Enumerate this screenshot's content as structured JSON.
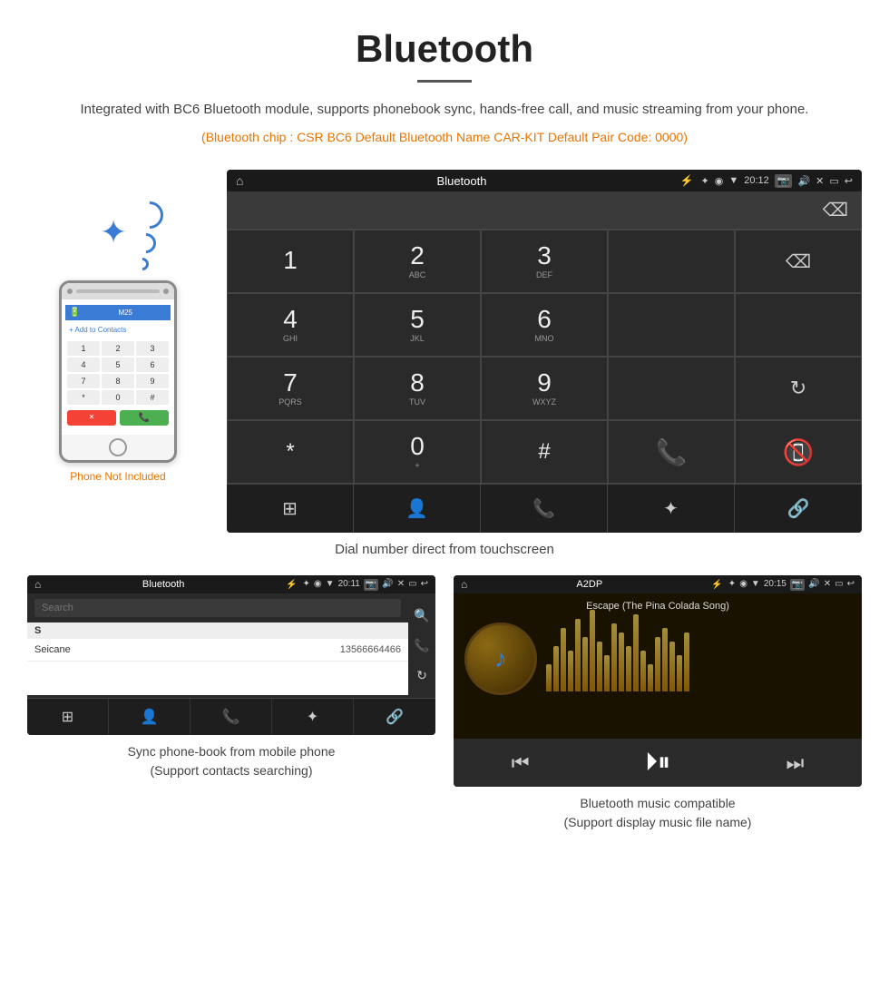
{
  "header": {
    "title": "Bluetooth",
    "underline": true,
    "description": "Integrated with BC6 Bluetooth module, supports phonebook sync, hands-free call, and music streaming from your phone.",
    "chip_info": "(Bluetooth chip : CSR BC6    Default Bluetooth Name CAR-KIT    Default Pair Code: 0000)"
  },
  "phone_illustration": {
    "not_included_label": "Phone Not Included"
  },
  "car_dial_screen": {
    "status_bar": {
      "title": "Bluetooth",
      "time": "20:12"
    },
    "dialpad": {
      "keys": [
        {
          "main": "1",
          "sub": ""
        },
        {
          "main": "2",
          "sub": "ABC"
        },
        {
          "main": "3",
          "sub": "DEF"
        },
        {
          "main": "4",
          "sub": "GHI"
        },
        {
          "main": "5",
          "sub": "JKL"
        },
        {
          "main": "6",
          "sub": "MNO"
        },
        {
          "main": "7",
          "sub": "PQRS"
        },
        {
          "main": "8",
          "sub": "TUV"
        },
        {
          "main": "9",
          "sub": "WXYZ"
        },
        {
          "main": "*",
          "sub": ""
        },
        {
          "main": "0",
          "sub": "+"
        },
        {
          "main": "#",
          "sub": ""
        }
      ]
    },
    "caption": "Dial number direct from touchscreen"
  },
  "phonebook_screen": {
    "status_bar": {
      "title": "Bluetooth",
      "time": "20:11"
    },
    "search_placeholder": "Search",
    "contacts": [
      {
        "letter": "S",
        "name": "Seicane",
        "number": "13566664466"
      }
    ],
    "caption_line1": "Sync phone-book from mobile phone",
    "caption_line2": "(Support contacts searching)"
  },
  "music_screen": {
    "status_bar": {
      "title": "A2DP",
      "time": "20:15"
    },
    "song_title": "Escape (The Pina Colada Song)",
    "visualizer_bars": [
      30,
      50,
      70,
      45,
      80,
      60,
      90,
      55,
      40,
      75,
      65,
      50,
      85,
      45,
      30,
      60,
      70,
      55,
      40,
      65
    ],
    "caption_line1": "Bluetooth music compatible",
    "caption_line2": "(Support display music file name)"
  }
}
